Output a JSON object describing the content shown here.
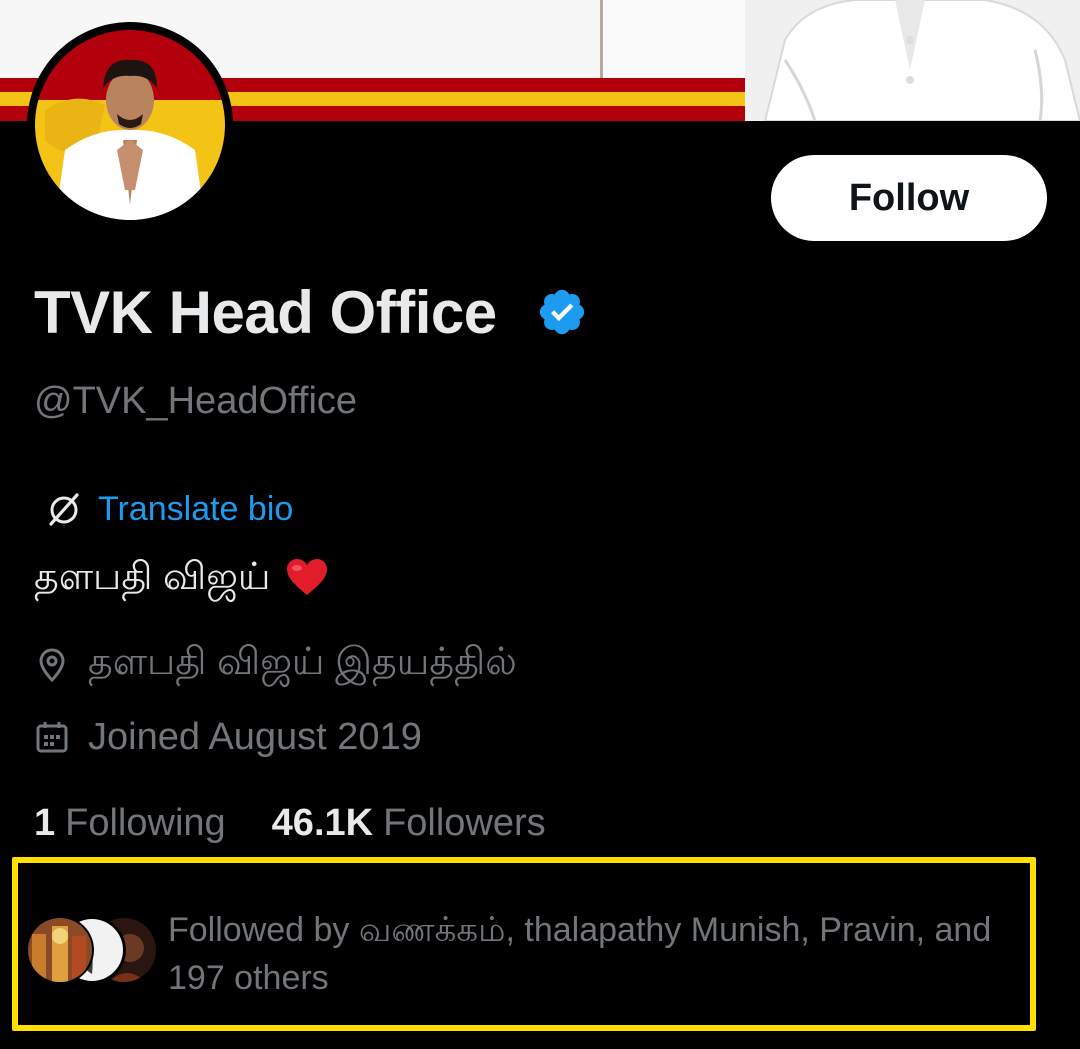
{
  "profile": {
    "display_name": "TVK Head Office",
    "handle": "@TVK_HeadOffice",
    "translate_label": "Translate bio",
    "bio": "தளபதி விஜய்",
    "location": "தளபதி விஜய் இதயத்தில்",
    "joined": "Joined August 2019"
  },
  "actions": {
    "follow_label": "Follow"
  },
  "stats": {
    "following_count": "1",
    "following_label": "Following",
    "followers_count": "46.1K",
    "followers_label": "Followers"
  },
  "followed_by": {
    "text": "Followed by வணக்கம், thalapathy Munish, Pravin, and 197 others"
  },
  "icons": [
    "verified-badge-icon",
    "globe-off-icon",
    "heart-icon",
    "location-pin-icon",
    "calendar-icon"
  ],
  "colors": {
    "background": "#000000",
    "text_primary": "#e7e9ea",
    "text_secondary": "#71767b",
    "link": "#1d9bf0",
    "verified": "#1d9bf0",
    "highlight_border": "#ffe000",
    "banner_red": "#b3000d",
    "banner_gold": "#f3c316"
  }
}
